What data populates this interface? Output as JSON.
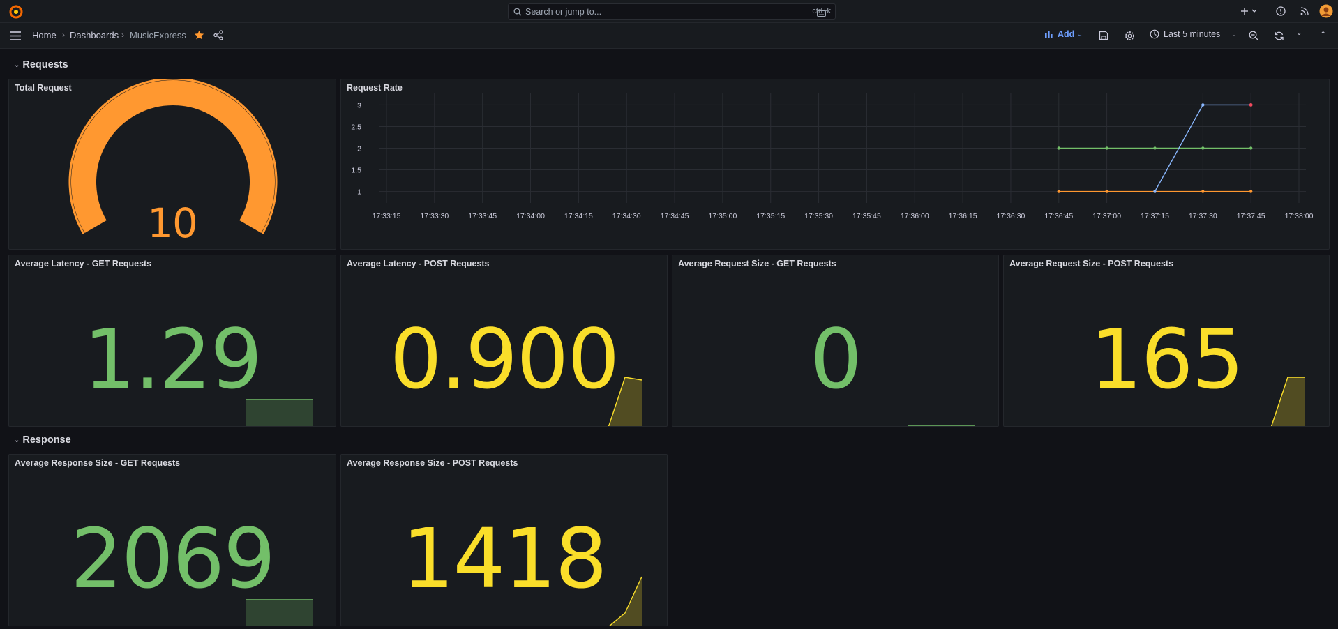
{
  "topbar": {
    "search_placeholder": "Search or jump to...",
    "search_shortcut": "ctrl+k",
    "icons": [
      "grafana-logo-icon",
      "keyboard-icon",
      "plus-icon",
      "chevron-down-icon",
      "help-icon",
      "news-rss-icon",
      "user-avatar-icon"
    ]
  },
  "nav": {
    "breadcrumb": [
      "Home",
      "Dashboards",
      "MusicExpress"
    ],
    "add_label": "Add",
    "time_range": "Last 5 minutes"
  },
  "rows": {
    "requests": "Requests",
    "response": "Response"
  },
  "panels": {
    "total_request": {
      "title": "Total Request",
      "value": "10",
      "color": "#ff9830",
      "gauge_fraction": 1.0
    },
    "request_rate": {
      "title": "Request Rate"
    },
    "avg_latency_get": {
      "title": "Average Latency - GET Requests",
      "value": "1.29",
      "color": "#73bf69"
    },
    "avg_latency_post": {
      "title": "Average Latency - POST Requests",
      "value": "0.900",
      "color": "#fade2a"
    },
    "avg_req_size_get": {
      "title": "Average Request Size - GET Requests",
      "value": "0",
      "color": "#73bf69"
    },
    "avg_req_size_post": {
      "title": "Average Request Size - POST Requests",
      "value": "165",
      "color": "#fade2a"
    },
    "avg_resp_size_get": {
      "title": "Average Response Size - GET Requests",
      "value": "2069",
      "color": "#73bf69"
    },
    "avg_resp_size_post": {
      "title": "Average Response Size - POST Requests",
      "value": "1418",
      "color": "#fade2a"
    }
  },
  "chart_data": {
    "type": "line",
    "x": [
      "17:33:15",
      "17:33:30",
      "17:33:45",
      "17:34:00",
      "17:34:15",
      "17:34:30",
      "17:34:45",
      "17:35:00",
      "17:35:15",
      "17:35:30",
      "17:35:45",
      "17:36:00",
      "17:36:15",
      "17:36:30",
      "17:36:45",
      "17:37:00",
      "17:37:15",
      "17:37:30",
      "17:37:45",
      "17:38:00"
    ],
    "ylim": [
      0.8,
      3.2
    ],
    "yticks": [
      1,
      1.5,
      2,
      2.5,
      3
    ],
    "grid": true,
    "series": [
      {
        "color": "#73bf69",
        "points": [
          [
            "17:36:45",
            2
          ],
          [
            "17:37:00",
            2
          ],
          [
            "17:37:15",
            2
          ],
          [
            "17:37:30",
            2
          ],
          [
            "17:37:45",
            2
          ]
        ]
      },
      {
        "color": "#ff9830",
        "points": [
          [
            "17:36:45",
            1
          ],
          [
            "17:37:00",
            1
          ],
          [
            "17:37:15",
            1
          ],
          [
            "17:37:30",
            1
          ],
          [
            "17:37:45",
            1
          ]
        ]
      },
      {
        "color": "#8ab8ff",
        "points": [
          [
            "17:37:15",
            1
          ],
          [
            "17:37:30",
            3
          ],
          [
            "17:37:45",
            3
          ]
        ]
      }
    ]
  }
}
